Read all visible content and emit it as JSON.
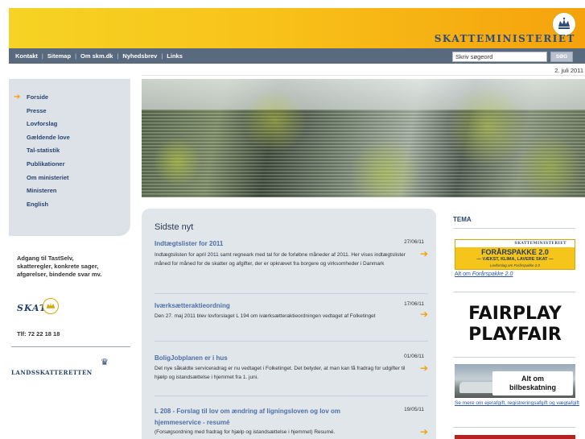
{
  "header": {
    "brand": "SKATTEMINISTERIET"
  },
  "nav": {
    "links": [
      "Kontakt",
      "Sitemap",
      "Om skm.dk",
      "Nyhedsbrev",
      "Links"
    ],
    "search_placeholder": "Skriv søgeord",
    "search_button": "SØG"
  },
  "date": "2. juli 2011",
  "sidebar": {
    "items": [
      "Forside",
      "Presse",
      "Lovforslag",
      "Gældende love",
      "Tal-statistik",
      "Publikationer",
      "Om ministeriet",
      "Ministeren",
      "English"
    ],
    "active": "Forside"
  },
  "left_lower": {
    "tastself": "Adgang til TastSelv, skatteregler, konkrete sager, afgørelser, bindende svar mv.",
    "skat_logo": "SKAT",
    "phone": "Tlf: 72 22 18 18",
    "lskr_logo": "LANDSSKATTERETTEN"
  },
  "news": {
    "title": "Sidste nyt",
    "items": [
      {
        "title": "Indtægtslister for 2011",
        "date": "27/06/11",
        "body": "Indtægtslisten for april 2011 samt regneark med tal for de forløbne måneder af 2011. Her vises indtægtslister måned for måned for de skatter og afgifter, der er opkrævet fra borgere og virksomheder i Danmark"
      },
      {
        "title": "Iværksætteraktieordning",
        "date": "17/06/11",
        "body": "Den 27. maj 2011 blev lovforslaget L 194 om iværksætteraktieordningen vedtaget af Folketinget"
      },
      {
        "title": "BoligJobplanen er i hus",
        "date": "01/06/11",
        "body": "Det nye såkaldte serviceradrag er nu vedtaget i Folketinget. Det betyder, at man kan få fradrag for udgifter til hjælp og istandsættelse i hjemmet fra 1. juni."
      },
      {
        "title": "L 208 - Forslag til lov om ændring af ligningsloven og lov om hjemmeservice - resumé",
        "date": "19/05/11",
        "body": "(Forsøgsordning med fradrag for hjælp og istandsættelse i hjemmet) Resumé."
      }
    ]
  },
  "tema": {
    "heading": "TEMA",
    "banner1": {
      "head": "SKATTEMINISTERIET",
      "title": "FORÅRSPAKKE 2.0",
      "sub": "— VÆKST, KLIMA, LAVERE SKAT —",
      "sub2": "Lovforslag om Forårspakke 2.0",
      "link_prefix": "Alt om ",
      "link_italic": "Forårspakke 2.0"
    },
    "fairplay": {
      "line1": "FAIRPLAY",
      "line2": "PLAYFAIR"
    },
    "car": {
      "label1": "Alt om",
      "label2": "bilbeskatning",
      "link": "Se mere om ejerafgift, registreringsafgift og vægtafgift"
    }
  },
  "colors": {
    "header_yellow": "#f8c21a",
    "nav_gray": "#596a7e",
    "link_blue": "#4d6fa5",
    "accent_orange": "#f2a00c"
  }
}
